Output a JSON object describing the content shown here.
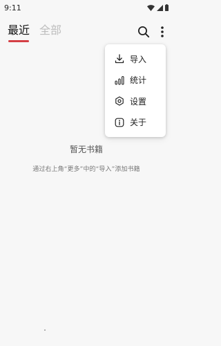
{
  "status_bar": {
    "time": "9:11",
    "icons": [
      "wifi-icon",
      "signal-icon",
      "battery-icon"
    ]
  },
  "tabs": [
    {
      "label": "最近",
      "active": true
    },
    {
      "label": "全部",
      "active": false
    }
  ],
  "toolbar": {
    "icons": [
      "search-icon",
      "more-vertical-icon"
    ]
  },
  "menu": {
    "items": [
      {
        "label": "导入",
        "icon": "download-icon"
      },
      {
        "label": "统计",
        "icon": "bar-chart-icon"
      },
      {
        "label": "设置",
        "icon": "settings-icon"
      },
      {
        "label": "关于",
        "icon": "info-icon"
      }
    ]
  },
  "empty_state": {
    "title": "暂无书籍",
    "hint": "通过右上角“更多”中的“导入”添加书籍"
  },
  "colors": {
    "accent": "#d43f45",
    "background": "#f7f7f7",
    "menu_background": "#ffffff",
    "inactive_tab": "#bdbdbd"
  }
}
